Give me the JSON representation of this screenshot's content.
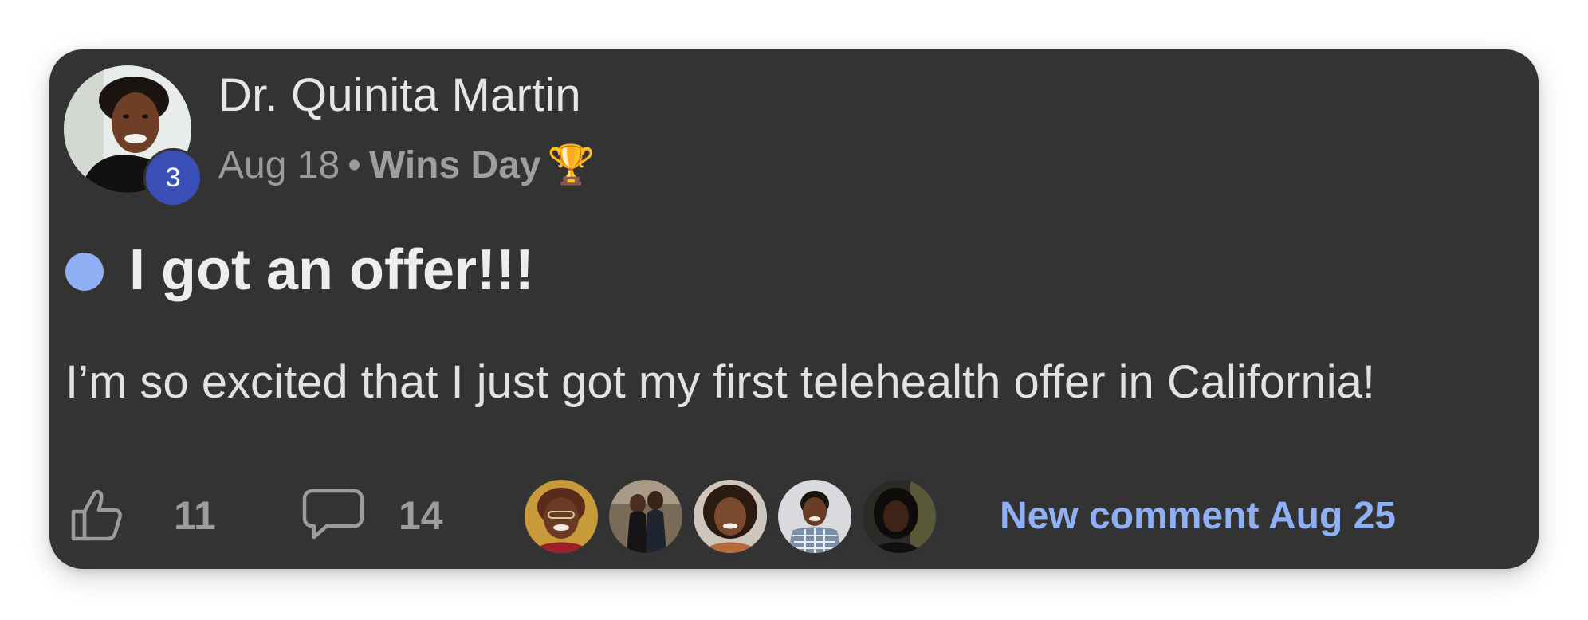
{
  "post": {
    "author": {
      "name": "Dr. Quinita Martin",
      "level": "3",
      "avatar_icon": "user-avatar-photo"
    },
    "meta": {
      "date": "Aug 18",
      "separator": "•",
      "category": "Wins Day",
      "category_icon": "🏆"
    },
    "title": "I got an offer!!!",
    "unread": true,
    "body": "I’m so excited that I just got my first telehealth offer in California!",
    "likes": {
      "icon": "thumbs-up-icon",
      "count": "11"
    },
    "comments": {
      "icon": "comment-bubble-icon",
      "count": "14"
    },
    "commenters_count": 5,
    "new_comment_label": "New comment Aug 25"
  },
  "colors": {
    "page_background": "#ffffff",
    "card_background": "#333333",
    "accent_blue": "#8fb0f5",
    "badge_blue": "#3b4fb8",
    "muted_text": "#9c9c9c",
    "primary_text": "#e8e8e8"
  }
}
